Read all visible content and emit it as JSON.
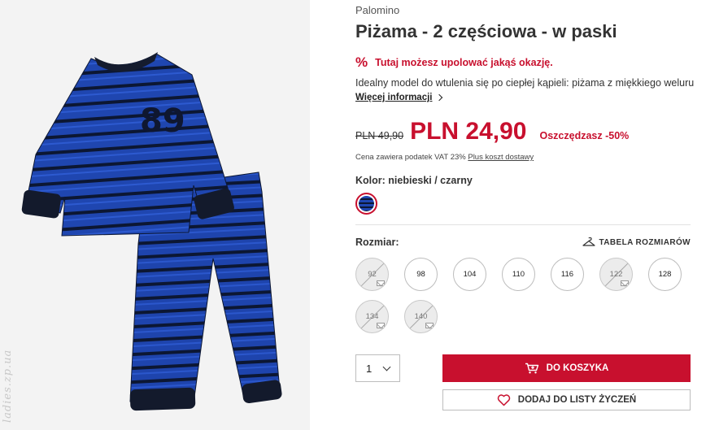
{
  "product": {
    "brand": "Palomino",
    "title": "Piżama - 2 częściowa - w paski",
    "promo_text": "Tutaj możesz upolować jakąś okazję.",
    "promo_icon": "percent-icon",
    "description": "Idealny model do wtulenia się po ciepłej kąpieli: piżama z miękkiego weluru",
    "more_info_label": "Więcej informacji",
    "image_number": "89",
    "watermark": "ladies.zp.ua"
  },
  "price": {
    "old": "PLN 49,90",
    "new": "PLN 24,90",
    "savings": "Oszczędzasz -50%",
    "vat_note": "Cena zawiera podatek VAT 23%",
    "shipping_link": "Plus koszt dostawy"
  },
  "color": {
    "label": "Kolor: niebieski / czarny",
    "swatch_colors": [
      "#1f46b0",
      "#0c1733"
    ]
  },
  "sizes": {
    "label": "Rozmiar:",
    "table_link": "TABELA ROZMIARÓW",
    "options": [
      {
        "value": "92",
        "available": false
      },
      {
        "value": "98",
        "available": true
      },
      {
        "value": "104",
        "available": true
      },
      {
        "value": "110",
        "available": true
      },
      {
        "value": "116",
        "available": true
      },
      {
        "value": "122",
        "available": false
      },
      {
        "value": "128",
        "available": true
      },
      {
        "value": "134",
        "available": false
      },
      {
        "value": "140",
        "available": false
      }
    ]
  },
  "actions": {
    "quantity": "1",
    "add_to_cart": "DO KOSZYKA",
    "add_to_wishlist": "DODAJ DO LISTY ŻYCZEŃ"
  },
  "colors": {
    "accent": "#c8102e",
    "fabric_blue": "#1f46b0",
    "fabric_dark": "#0c1733"
  }
}
